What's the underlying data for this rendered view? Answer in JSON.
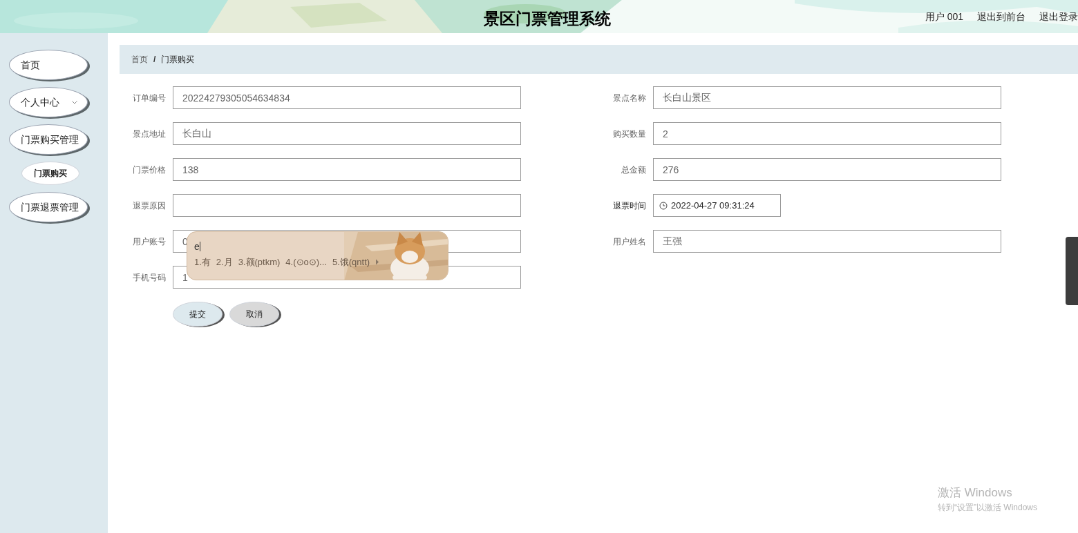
{
  "header": {
    "title": "景区门票管理系统",
    "links": [
      "用户 001",
      "退出到前台",
      "退出登录"
    ]
  },
  "sidebar": {
    "items": [
      {
        "label": "首页",
        "selected": false
      },
      {
        "label": "个人中心",
        "expanded": false,
        "selected": false
      },
      {
        "label": "门票购买管理",
        "expanded": true,
        "selected": false,
        "children": [
          {
            "label": "门票购买",
            "selected": true
          }
        ]
      },
      {
        "label": "门票退票管理",
        "selected": false
      }
    ]
  },
  "breadcrumb": [
    "首页",
    "/",
    "门票购买"
  ],
  "form": {
    "left": [
      {
        "label": "订单编号",
        "value": "20224279305054634834",
        "kind": "text"
      },
      {
        "label": "景点地址",
        "value": "长白山",
        "kind": "text"
      },
      {
        "label": "门票价格",
        "value": "138",
        "kind": "text"
      },
      {
        "label": "退票原因",
        "kind": "text"
      },
      {
        "label": "用户账号",
        "value": "0",
        "kind": "text"
      },
      {
        "label": "手机号码",
        "value": "1",
        "kind": "text"
      }
    ],
    "right": [
      {
        "label": "景点名称",
        "value": "长白山景区",
        "kind": "text"
      },
      {
        "label": "购买数量",
        "value": "2",
        "kind": "text"
      },
      {
        "label": "总金额",
        "value": "276",
        "kind": "text"
      },
      {
        "label": "退票时间",
        "value": "2022-04-27 09:31:24",
        "kind": "datetime"
      },
      {
        "label": "用户姓名",
        "value": "王强",
        "kind": "text"
      }
    ],
    "buttons": [
      {
        "label": "提交",
        "kind": "primary"
      },
      {
        "label": "取消",
        "kind": "secondary"
      }
    ]
  },
  "ime": {
    "input": "e",
    "candidates": [
      "1.有",
      "2.月",
      "3.额(ptkm)",
      "4.(⊙o⊙)...",
      "5.饿(qntt)"
    ]
  },
  "os_notice": {
    "title": "激活 Windows",
    "subtitle": "转到“设置”以激活 Windows"
  }
}
